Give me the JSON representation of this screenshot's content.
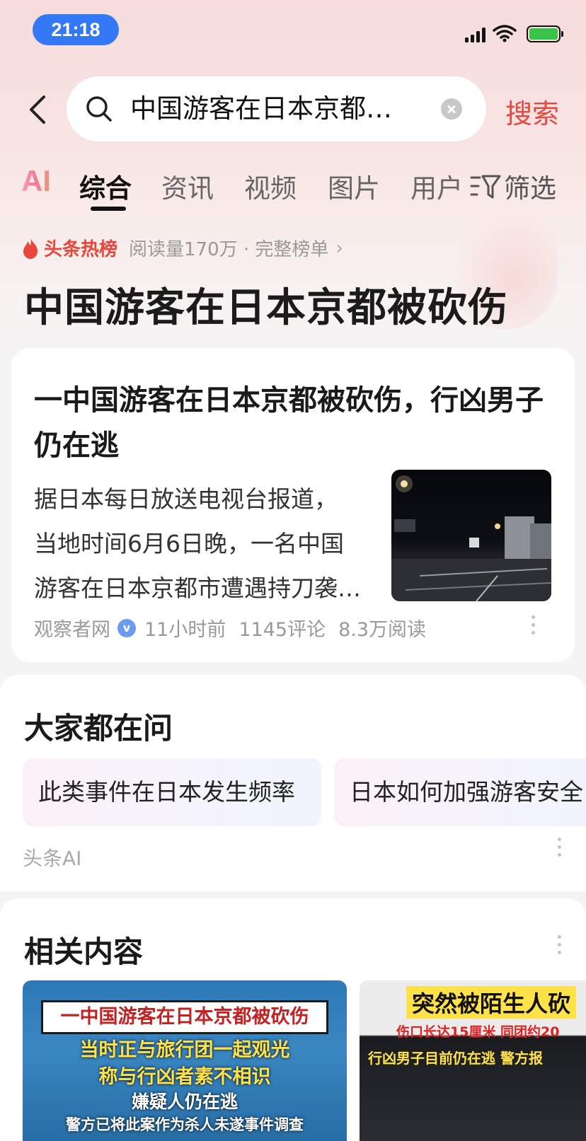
{
  "status_bar": {
    "time": "21:18"
  },
  "search": {
    "query": "中国游客在日本京都…",
    "submit_label": "搜索"
  },
  "tabs": {
    "ai_label": "AI",
    "items": [
      "综合",
      "资讯",
      "视频",
      "图片",
      "用户"
    ],
    "active": "综合",
    "filter_label": "筛选"
  },
  "hot": {
    "label": "头条热榜",
    "meta": "阅读量170万 · 完整榜单",
    "chevron": "›",
    "headline": "中国游客在日本京都被砍伤"
  },
  "article": {
    "title": "一中国游客在日本京都被砍伤，行凶男子仍在逃",
    "summary_lines": [
      "据日本每日放送电视台报道，",
      "当地时间6月6日晚，一名中国",
      "游客在日本京都市遭遇持刀袭…"
    ],
    "source": "观察者网",
    "verified_glyph": "v",
    "time": "11小时前",
    "comments": "1145评论",
    "reads": "8.3万阅读"
  },
  "ask": {
    "title": "大家都在问",
    "chips": [
      "此类事件在日本发生频率",
      "日本如何加强游客安全"
    ],
    "source": "头条AI"
  },
  "related": {
    "title": "相关内容",
    "thumb1_lines": [
      "一中国游客在日本京都被砍伤",
      "当时正与旅行团一起观光",
      "称与行凶者素不相识",
      "嫌疑人仍在逃",
      "警方已将此案作为杀人未遂事件调查"
    ],
    "thumb2_lines": [
      "突然被陌生人砍",
      "伤口长达15厘米 同团约20",
      "行凶男子目前仍在逃 警方报"
    ]
  },
  "colors": {
    "accent_red": "#e8473e",
    "status_pill": "#3478f6",
    "battery_green": "#3ac34a"
  }
}
